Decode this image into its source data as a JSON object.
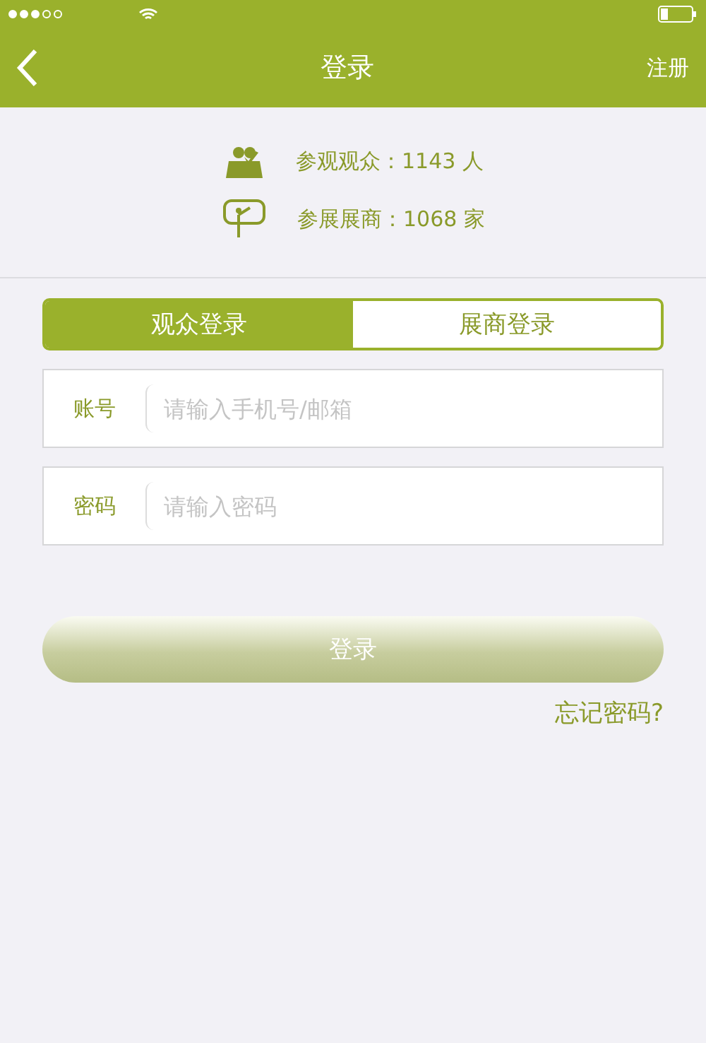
{
  "nav_bar": {
    "title": "登录",
    "action": "注册"
  },
  "stats": [
    {
      "kind": "audience",
      "text": "参观观众：1143 人"
    },
    {
      "kind": "exhibitor",
      "text": "参展展商：1068 家"
    }
  ],
  "tabs": [
    {
      "label": "观众登录",
      "selected": true
    },
    {
      "label": "展商登录",
      "selected": false
    }
  ],
  "fields": [
    {
      "label": "账号",
      "placeholder": "请输入手机号/邮箱"
    },
    {
      "label": "密码",
      "placeholder": "请输入密码"
    }
  ],
  "login_button": {
    "label": "登录",
    "disabled": true
  },
  "forgot_link": "忘记密码?"
}
